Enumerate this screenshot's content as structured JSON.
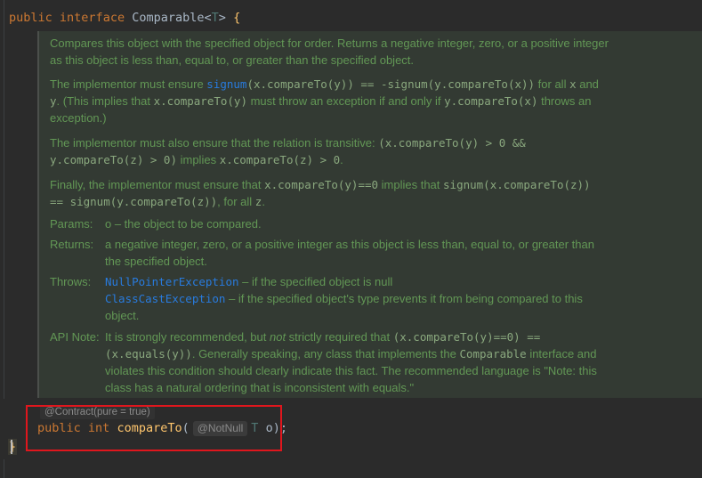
{
  "decl": {
    "public": "public",
    "interface": "interface",
    "name": "Comparable",
    "lt": "<",
    "T": "T",
    "gt": ">",
    "brace": "{"
  },
  "doc": {
    "p1": "Compares this object with the specified object for order. Returns a negative integer, zero, or a positive integer as this object is less than, equal to, or greater than the specified object.",
    "p2": {
      "a": "The implementor must ensure ",
      "link": "signum",
      "b": "(x.compareTo(y)) == -signum(y.compareTo(x))",
      "c": " for all ",
      "x": "x",
      "and": " and ",
      "y": "y",
      "d": ". (This implies that ",
      "e": "x.compareTo(y)",
      "f": " must throw an exception if and only if ",
      "g": "y.compareTo(x)",
      "h": " throws an exception.)"
    },
    "p3": {
      "a": "The implementor must also ensure that the relation is transitive: ",
      "b": "(x.compareTo(y) > 0 && y.compareTo(z) > 0)",
      "c": " implies ",
      "d": "x.compareTo(z) > 0",
      "e": "."
    },
    "p4": {
      "a": "Finally, the implementor must ensure that ",
      "b": "x.compareTo(y)==0",
      "c": " implies that ",
      "d": "signum(x.compareTo(z)) == signum(y.compareTo(z))",
      "e": ", for all ",
      "f": "z",
      "g": "."
    },
    "params": {
      "label": "Params:",
      "value": "o – the object to be compared."
    },
    "returns": {
      "label": "Returns:",
      "value": "a negative integer, zero, or a positive integer as this object is less than, equal to, or greater than the specified object."
    },
    "throws": {
      "label": "Throws:",
      "ex1": "NullPointerException",
      "ex1_desc": " – if the specified object is null",
      "ex2": "ClassCastException",
      "ex2_desc": " – if the specified object's type prevents it from being compared to this object."
    },
    "apinote": {
      "label": "API Note:",
      "a": "It is strongly recommended, but ",
      "em": "not",
      "b": " strictly required that ",
      "c": "(x.compareTo(y)==0) == (x.equals(y))",
      "d": ". Generally speaking, any class that implements the ",
      "e": "Comparable",
      "f": " interface and violates this condition should clearly indicate this fact. The recommended language is \"Note: this class has a natural ordering that is inconsistent with equals.\""
    }
  },
  "method": {
    "annotation": "@Contract(pure = true)",
    "public": "public",
    "int": "int",
    "name": "compareTo",
    "open": "(",
    "notnull": "@NotNull",
    "type": "T",
    "param": "o",
    "close": ");"
  },
  "closing_brace": "}",
  "colors": {
    "keyword": "#cc7832",
    "method": "#ffc66d",
    "doc": "#629755",
    "link": "#287bde",
    "highlight": "#e0161d"
  }
}
